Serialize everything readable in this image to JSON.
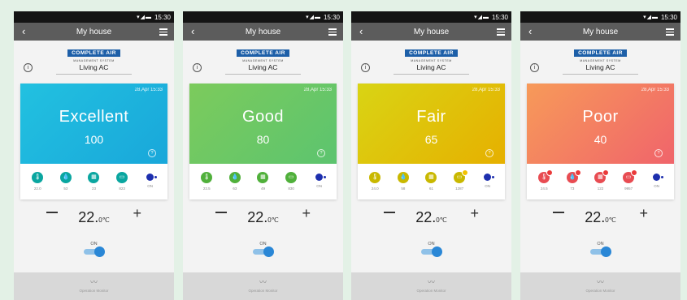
{
  "status_time": "15:30",
  "title": "My house",
  "logo_main": "COMPLETE AIR",
  "logo_sub": "MANAGEMENT SYSTEM",
  "device": "Living AC",
  "date": "28,Apr 15:33",
  "temperature": "22.",
  "temp_unit": "0℃",
  "power_label": "ON",
  "footer_label": "Operation Monitor",
  "screens": [
    {
      "status": "Excellent",
      "score": "100",
      "gradient_from": "#22c1e0",
      "gradient_to": "#19a7da",
      "icon_color": "#0aa6a0",
      "metrics": [
        "22.0",
        "53",
        "23",
        "823",
        "ON"
      ]
    },
    {
      "status": "Good",
      "score": "80",
      "gradient_from": "#7ccb5c",
      "gradient_to": "#5cc46f",
      "icon_color": "#50b03b",
      "metrics": [
        "23.5",
        "63",
        "49",
        "830",
        "ON"
      ]
    },
    {
      "status": "Fair",
      "score": "65",
      "gradient_from": "#d9d414",
      "gradient_to": "#e6b000",
      "icon_color": "#c9b800",
      "metrics": [
        "24.0",
        "58",
        "61",
        "1287",
        "ON"
      ]
    },
    {
      "status": "Poor",
      "score": "40",
      "gradient_from": "#f79a59",
      "gradient_to": "#f0646b",
      "icon_color": "#e84c52",
      "metrics": [
        "24.5",
        "73",
        "122",
        "9957",
        "ON"
      ]
    }
  ]
}
